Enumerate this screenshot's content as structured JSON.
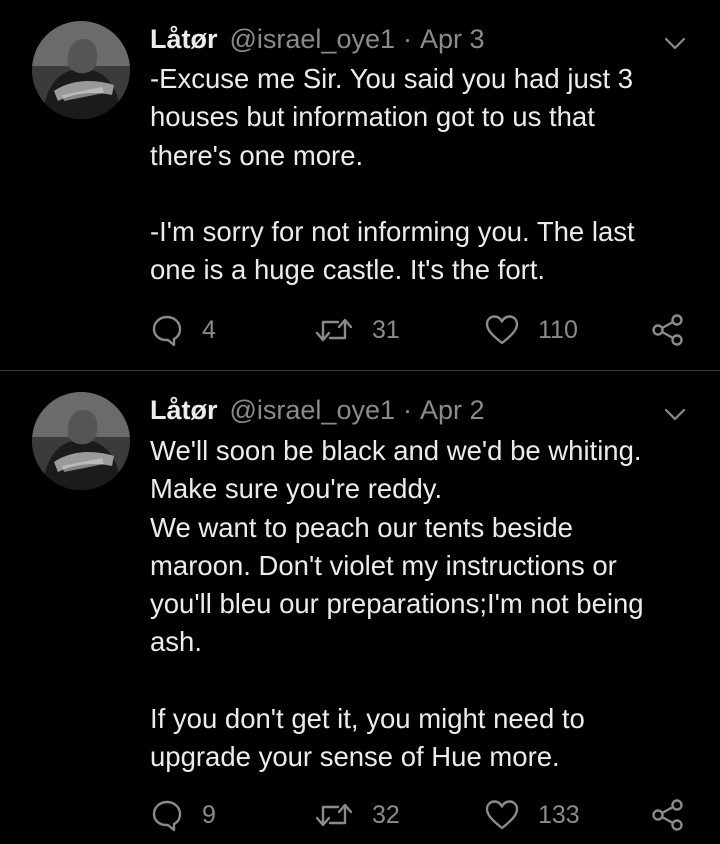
{
  "tweets": [
    {
      "name": "Låtør",
      "handle": "@israel_oye1",
      "separator": "·",
      "date": "Apr 3",
      "text": "-Excuse me Sir. You said you had just 3\nhouses but information got to us that\nthere's one more.\n\n-I'm sorry for not informing you. The last\none is a huge castle. It's the fort.",
      "replies": "4",
      "retweets": "31",
      "likes": "110"
    },
    {
      "name": "Låtør",
      "handle": "@israel_oye1",
      "separator": "·",
      "date": "Apr 2",
      "text": "We'll soon be black and we'd be whiting.\nMake sure you're reddy.\nWe want to peach our tents beside\nmaroon. Don't violet my instructions or\nyou'll bleu our preparations;I'm not being\nash.\n\nIf you don't get it, you might need to\nupgrade your sense of Hue more.",
      "replies": "9",
      "retweets": "32",
      "likes": "133"
    }
  ],
  "icons": {
    "reply": "reply-icon",
    "retweet": "retweet-icon",
    "like": "heart-icon",
    "share": "share-icon",
    "caret": "chevron-down-icon"
  },
  "colors": {
    "background": "#000000",
    "text": "#ececec",
    "secondary": "#8b8b8b",
    "divider": "#3a3a3a"
  }
}
